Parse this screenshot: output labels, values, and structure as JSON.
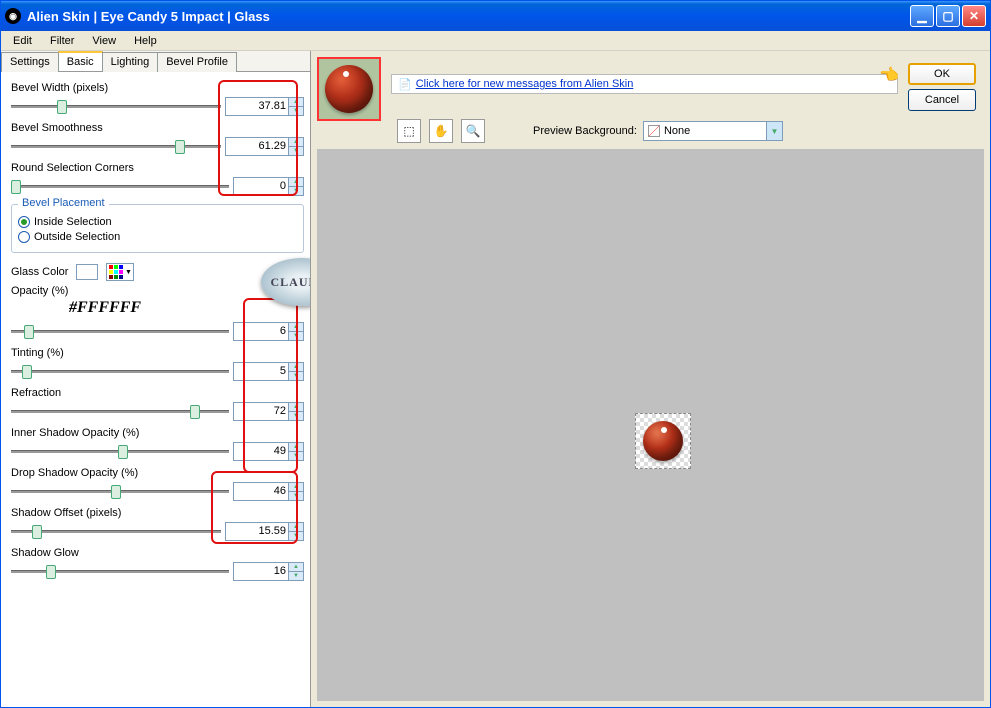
{
  "title": "Alien Skin  |  Eye Candy 5 Impact  |  Glass",
  "menus": [
    "Edit",
    "Filter",
    "View",
    "Help"
  ],
  "tabs": [
    {
      "label": "Settings",
      "active": false
    },
    {
      "label": "Basic",
      "active": true
    },
    {
      "label": "Lighting",
      "active": false
    },
    {
      "label": "Bevel Profile",
      "active": false
    }
  ],
  "params": {
    "bevel_width": {
      "label": "Bevel Width (pixels)",
      "value": "37.81",
      "pos": 22
    },
    "bevel_smoothness": {
      "label": "Bevel Smoothness",
      "value": "61.29",
      "pos": 78
    },
    "round_corners": {
      "label": "Round Selection Corners",
      "value": "0",
      "pos": 0
    },
    "opacity": {
      "label": "Opacity (%)",
      "value": "6",
      "pos": 6
    },
    "tinting": {
      "label": "Tinting (%)",
      "value": "5",
      "pos": 5
    },
    "refraction": {
      "label": "Refraction",
      "value": "72",
      "pos": 82
    },
    "inner_shadow": {
      "label": "Inner Shadow Opacity (%)",
      "value": "49",
      "pos": 49
    },
    "drop_shadow": {
      "label": "Drop Shadow Opacity (%)",
      "value": "46",
      "pos": 46
    },
    "shadow_offset": {
      "label": "Shadow Offset (pixels)",
      "value": "15.59",
      "pos": 10
    },
    "shadow_glow": {
      "label": "Shadow Glow",
      "value": "16",
      "pos": 16
    }
  },
  "bevel_placement": {
    "legend": "Bevel Placement",
    "options": [
      {
        "label": "Inside Selection",
        "selected": true
      },
      {
        "label": "Outside Selection",
        "selected": false
      }
    ]
  },
  "glass_color_label": "Glass Color",
  "glass_color_hex": "#FFFFFF",
  "badge": "CLAUDIA",
  "message_link": "Click here for new messages from Alien Skin",
  "preview_bg_label": "Preview Background:",
  "preview_bg_value": "None",
  "buttons": {
    "ok": "OK",
    "cancel": "Cancel"
  }
}
